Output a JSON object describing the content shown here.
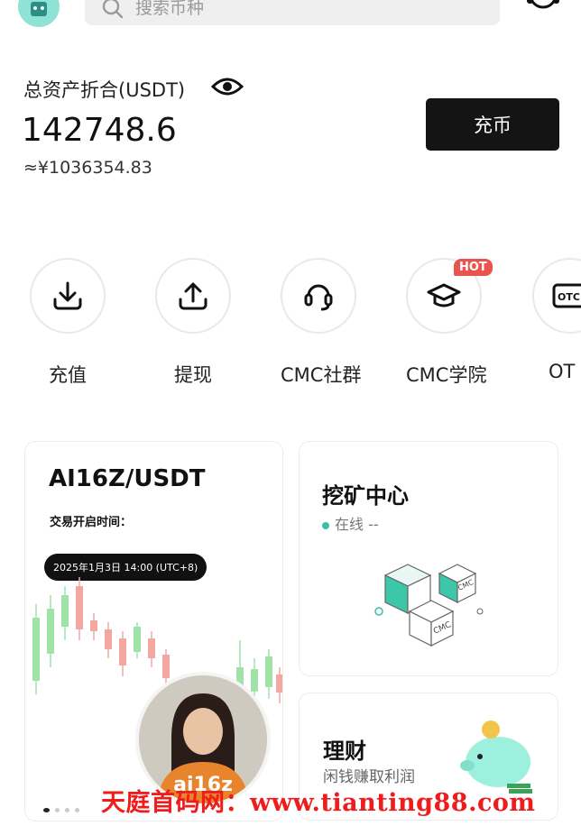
{
  "search": {
    "placeholder": "搜索币种"
  },
  "balance": {
    "label": "总资产折合(USDT)",
    "value": "142748.6",
    "cny": "≈¥1036354.83",
    "deposit_button": "充币"
  },
  "quick_actions": [
    {
      "label": "充值",
      "icon": "download-icon"
    },
    {
      "label": "提现",
      "icon": "upload-icon"
    },
    {
      "label": "CMC社群",
      "icon": "headset-icon"
    },
    {
      "label": "CMC学院",
      "icon": "graduation-cap-icon",
      "badge": "HOT"
    },
    {
      "label": "OT",
      "icon": "otc-icon"
    }
  ],
  "promo_card": {
    "title": "AI16Z/USDT",
    "subtitle": "交易开启时间：",
    "time": "2025年1月3日 14:00 (UTC+8)",
    "logo_text": "ai16z"
  },
  "mining_card": {
    "title": "挖矿中心",
    "status": "在线 --",
    "cube_labels": [
      "CMC",
      "CMC"
    ]
  },
  "finance_card": {
    "title": "理财",
    "subtitle": "闲钱赚取利润"
  },
  "watermark": "天庭首码网：www.tianting88.com",
  "colors": {
    "accent": "#35c2a5",
    "hot": "#e9544f",
    "button": "#141414",
    "watermark": "#ee1c1c"
  }
}
